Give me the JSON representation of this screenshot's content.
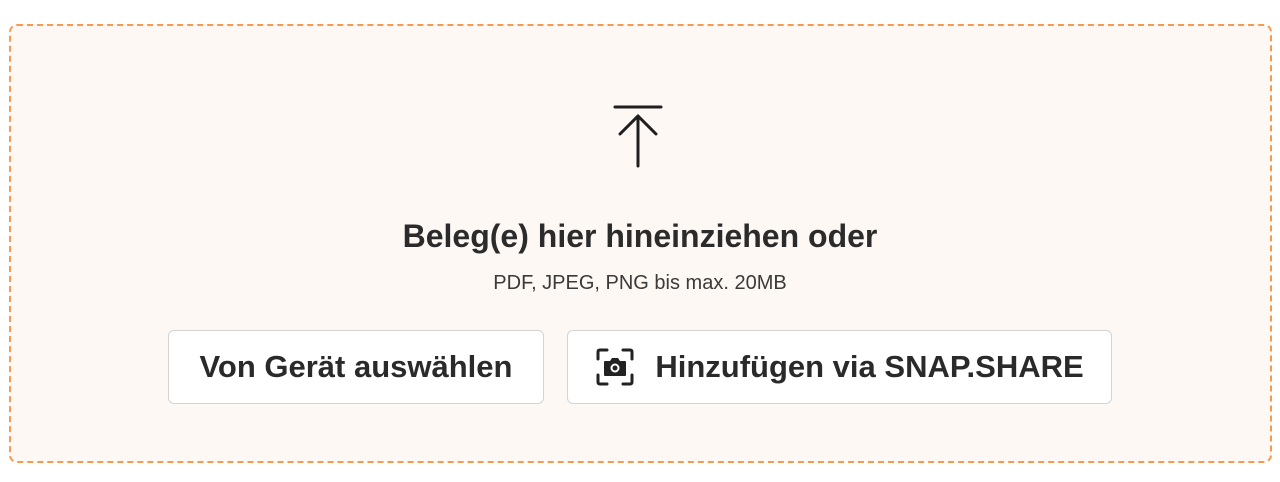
{
  "dropzone": {
    "icon": "upload-arrow-icon",
    "title": "Beleg(e) hier hineinziehen oder",
    "hint": "PDF, JPEG, PNG bis max. 20MB",
    "border_color": "#f59a4e",
    "background_color": "#fdf8f4"
  },
  "actions": {
    "device_button_label": "Von Gerät auswählen",
    "snap_button_label": "Hinzufügen via SNAP.SHARE",
    "snap_button_icon": "camera-scan-icon"
  }
}
